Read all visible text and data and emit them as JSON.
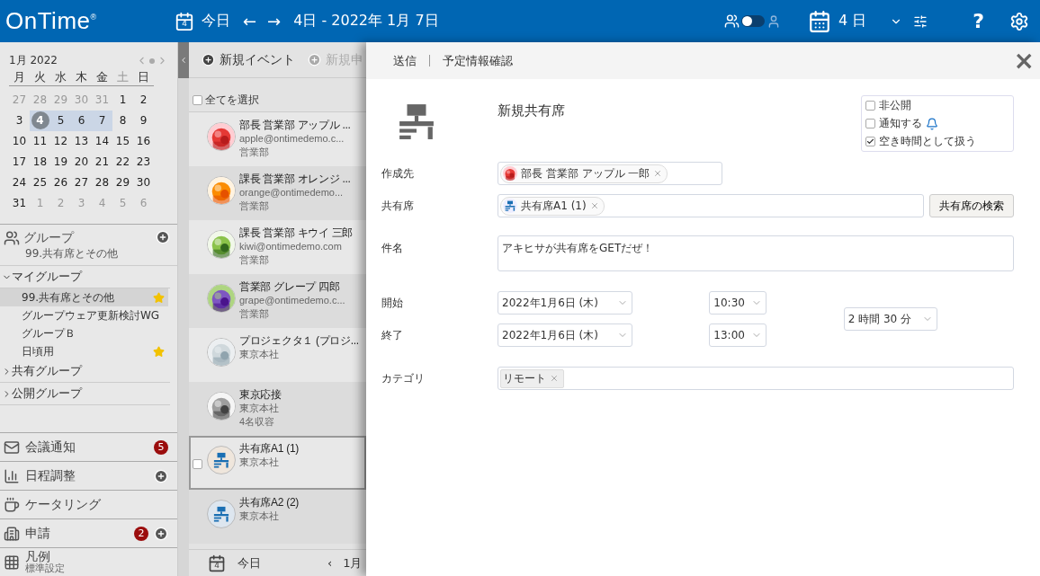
{
  "header": {
    "logo": "OnTime",
    "logo_mark": "®",
    "today_icon_day": "4",
    "today": "今日",
    "prev": "←",
    "next": "→",
    "range": "4日 - 2022年 1月 7日",
    "person_toggle": {
      "on": false
    },
    "view": "4 日",
    "help": "?"
  },
  "calendar": {
    "month": "1月 2022",
    "weekdays": [
      {
        "label": "月",
        "weekend": false
      },
      {
        "label": "火",
        "weekend": false
      },
      {
        "label": "水",
        "weekend": false
      },
      {
        "label": "木",
        "weekend": false
      },
      {
        "label": "金",
        "weekend": false
      },
      {
        "label": "土",
        "weekend": true
      },
      {
        "label": "日",
        "weekend": false
      }
    ],
    "weeks": [
      [
        {
          "d": "27",
          "muted": true,
          "selected": false,
          "today": false
        },
        {
          "d": "28",
          "muted": true,
          "selected": false,
          "today": false
        },
        {
          "d": "29",
          "muted": true,
          "selected": false,
          "today": false
        },
        {
          "d": "30",
          "muted": true,
          "selected": false,
          "today": false
        },
        {
          "d": "31",
          "muted": true,
          "selected": false,
          "today": false
        },
        {
          "d": "1",
          "muted": false,
          "selected": false,
          "today": false
        },
        {
          "d": "2",
          "muted": false,
          "selected": false,
          "today": false
        }
      ],
      [
        {
          "d": "3",
          "muted": false,
          "selected": false,
          "today": false
        },
        {
          "d": "4",
          "muted": false,
          "selected": true,
          "today": true
        },
        {
          "d": "5",
          "muted": false,
          "selected": true,
          "today": false
        },
        {
          "d": "6",
          "muted": false,
          "selected": true,
          "today": false
        },
        {
          "d": "7",
          "muted": false,
          "selected": true,
          "today": false
        },
        {
          "d": "8",
          "muted": false,
          "selected": false,
          "today": false
        },
        {
          "d": "9",
          "muted": false,
          "selected": false,
          "today": false
        }
      ],
      [
        {
          "d": "10",
          "muted": false,
          "selected": false,
          "today": false
        },
        {
          "d": "11",
          "muted": false,
          "selected": false,
          "today": false
        },
        {
          "d": "12",
          "muted": false,
          "selected": false,
          "today": false
        },
        {
          "d": "13",
          "muted": false,
          "selected": false,
          "today": false
        },
        {
          "d": "14",
          "muted": false,
          "selected": false,
          "today": false
        },
        {
          "d": "15",
          "muted": false,
          "selected": false,
          "today": false
        },
        {
          "d": "16",
          "muted": false,
          "selected": false,
          "today": false
        }
      ],
      [
        {
          "d": "17",
          "muted": false,
          "selected": false,
          "today": false
        },
        {
          "d": "18",
          "muted": false,
          "selected": false,
          "today": false
        },
        {
          "d": "19",
          "muted": false,
          "selected": false,
          "today": false
        },
        {
          "d": "20",
          "muted": false,
          "selected": false,
          "today": false
        },
        {
          "d": "21",
          "muted": false,
          "selected": false,
          "today": false
        },
        {
          "d": "22",
          "muted": false,
          "selected": false,
          "today": false
        },
        {
          "d": "23",
          "muted": false,
          "selected": false,
          "today": false
        }
      ],
      [
        {
          "d": "24",
          "muted": false,
          "selected": false,
          "today": false
        },
        {
          "d": "25",
          "muted": false,
          "selected": false,
          "today": false
        },
        {
          "d": "26",
          "muted": false,
          "selected": false,
          "today": false
        },
        {
          "d": "27",
          "muted": false,
          "selected": false,
          "today": false
        },
        {
          "d": "28",
          "muted": false,
          "selected": false,
          "today": false
        },
        {
          "d": "29",
          "muted": false,
          "selected": false,
          "today": false
        },
        {
          "d": "30",
          "muted": false,
          "selected": false,
          "today": false
        }
      ],
      [
        {
          "d": "31",
          "muted": false,
          "selected": false,
          "today": false
        },
        {
          "d": "1",
          "muted": true,
          "selected": false,
          "today": false
        },
        {
          "d": "2",
          "muted": true,
          "selected": false,
          "today": false
        },
        {
          "d": "3",
          "muted": true,
          "selected": false,
          "today": false
        },
        {
          "d": "4",
          "muted": true,
          "selected": false,
          "today": false
        },
        {
          "d": "5",
          "muted": true,
          "selected": false,
          "today": false
        },
        {
          "d": "6",
          "muted": true,
          "selected": false,
          "today": false
        }
      ]
    ]
  },
  "groups": {
    "title": "グループ",
    "subtitle": "99.共有席とその他",
    "sections": [
      {
        "label": "マイグループ",
        "expanded": true,
        "items": [
          {
            "label": "99.共有席とその他",
            "selected": true,
            "favorite": true
          },
          {
            "label": "グループウェア更新検討WG",
            "selected": false,
            "favorite": false
          },
          {
            "label": "グループＢ",
            "selected": false,
            "favorite": false
          },
          {
            "label": "日頃用",
            "selected": false,
            "favorite": true
          }
        ]
      },
      {
        "label": "共有グループ",
        "expanded": false
      },
      {
        "label": "公開グループ",
        "expanded": false
      }
    ]
  },
  "nav": [
    {
      "kind": "mail",
      "label": "会議通知",
      "badge": "5",
      "add": false
    },
    {
      "kind": "chart",
      "label": "日程調整",
      "add": true
    },
    {
      "kind": "cup",
      "label": "ケータリング",
      "add": false
    },
    {
      "kind": "building",
      "label": "申請",
      "badge": "2",
      "add": true
    },
    {
      "kind": "grid",
      "label": "凡例",
      "subtitle": "標準設定",
      "add": false
    }
  ],
  "list": {
    "new_event": "新規イベント",
    "new_request": "新規申",
    "select_all": "全てを選択",
    "select_all_checked": false,
    "rows": [
      {
        "kind": "picture",
        "lines": [
          "部長 営業部 アップル ...",
          "apple@ontimedemo.c...",
          "営業部"
        ],
        "selected": false,
        "shaded": false
      },
      {
        "kind": "picture",
        "lines": [
          "課長 営業部 オレンジ ...",
          "orange@ontimedemo...",
          "営業部"
        ],
        "selected": false,
        "shaded": true
      },
      {
        "kind": "picture",
        "lines": [
          "課長 営業部 キウイ 三郎",
          "kiwi@ontimedemo.com",
          "営業部"
        ],
        "selected": false,
        "shaded": false
      },
      {
        "kind": "picture",
        "lines": [
          "営業部 グレープ 四郎",
          "grape@ontimedemo.c...",
          "営業部"
        ],
        "selected": false,
        "shaded": true
      },
      {
        "kind": "picture",
        "lines": [
          "プロジェクタ１ (プロジ...",
          "東京本社"
        ],
        "selected": false,
        "shaded": false
      },
      {
        "kind": "picture",
        "lines": [
          "東京応接",
          "東京本社",
          "4名収容"
        ],
        "selected": false,
        "shaded": true
      },
      {
        "kind": "desk",
        "lines": [
          "共有席A1 (1)",
          "東京本社"
        ],
        "selected": true,
        "shaded": false
      },
      {
        "kind": "desk",
        "lines": [
          "共有席A2 (2)",
          "東京本社"
        ],
        "selected": false,
        "shaded": true
      }
    ],
    "footer": {
      "today_icon_day": "4",
      "today": "今日",
      "prev": "‹",
      "month": "1月"
    }
  },
  "dialog": {
    "actions": [
      "送信",
      "予定情報確認"
    ],
    "close": "×",
    "title": "新規共有席",
    "options": [
      {
        "label": "非公開",
        "checked": false,
        "bell": false
      },
      {
        "label": "通知する",
        "checked": false,
        "bell": true
      },
      {
        "label": "空き時間として扱う",
        "checked": true,
        "bell": false
      }
    ],
    "organizer": {
      "label": "作成先",
      "chip": "部長 営業部 アップル 一郎"
    },
    "seat": {
      "label": "共有席",
      "chip": "共有席A1 (1)",
      "button": "共有席の検索"
    },
    "subject": {
      "label": "件名",
      "value": "アキヒサが共有席をGETだぜ！"
    },
    "start": {
      "label": "開始",
      "date": "2022年1月6日 (木)",
      "time": "10:30"
    },
    "end": {
      "label": "終了",
      "date": "2022年1月6日 (木)",
      "time": "13:00"
    },
    "duration": "2 時間 30 分",
    "category": {
      "label": "カテゴリ",
      "chip": "リモート"
    }
  }
}
